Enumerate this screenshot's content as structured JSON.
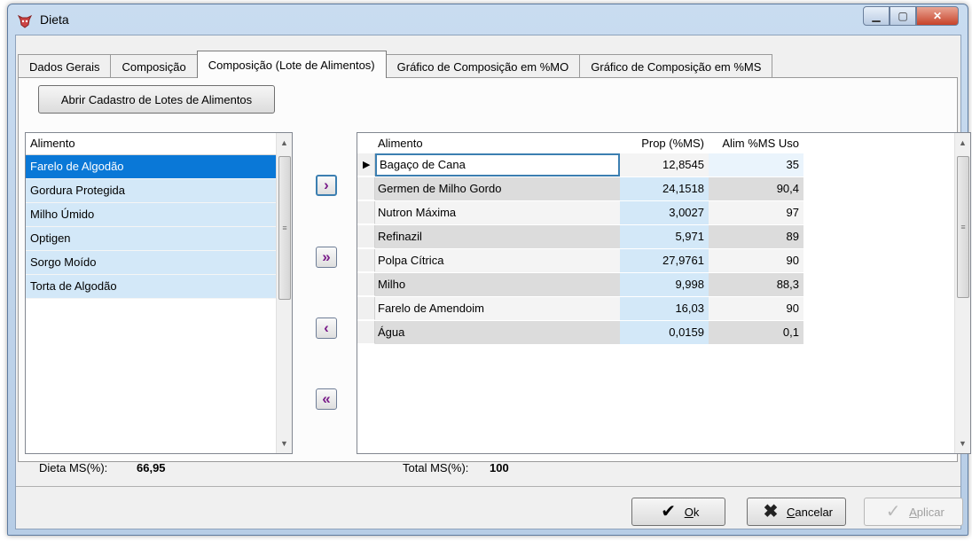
{
  "window": {
    "title": "Dieta"
  },
  "tabs": [
    {
      "label": "Dados Gerais"
    },
    {
      "label": "Composição"
    },
    {
      "label": "Composição (Lote de Alimentos)"
    },
    {
      "label": "Gráfico de Composição em %MO"
    },
    {
      "label": "Gráfico de Composição em %MS"
    }
  ],
  "active_tab": "Composição (Lote de Alimentos)",
  "open_lots_button": "Abrir Cadastro de Lotes de Alimentos",
  "left_list": {
    "header": "Alimento",
    "selected": "Farelo de Algodão",
    "items": [
      "Farelo de Algodão",
      "Gordura Protegida",
      "Milho Úmido",
      "Optigen",
      "Sorgo Moído",
      "Torta de Algodão"
    ]
  },
  "move_buttons": {
    "add_one": "›",
    "add_all": "»",
    "remove_one": "‹",
    "remove_all": "«"
  },
  "grid": {
    "headers": [
      "Alimento",
      "Prop (%MS)",
      "Alim %MS Uso"
    ],
    "rows": [
      {
        "alimento": "Bagaço de Cana",
        "prop": "12,8545",
        "ms": "35"
      },
      {
        "alimento": "Germen de Milho Gordo",
        "prop": "24,1518",
        "ms": "90,4"
      },
      {
        "alimento": "Nutron Máxima",
        "prop": "3,0027",
        "ms": "97"
      },
      {
        "alimento": "Refinazil",
        "prop": "5,971",
        "ms": "89"
      },
      {
        "alimento": "Polpa Cítrica",
        "prop": "27,9761",
        "ms": "90"
      },
      {
        "alimento": "Milho",
        "prop": "9,998",
        "ms": "88,3"
      },
      {
        "alimento": "Farelo de Amendoim",
        "prop": "16,03",
        "ms": "90"
      },
      {
        "alimento": "Água",
        "prop": "0,0159",
        "ms": "0,1"
      }
    ],
    "current_row_indicator": "▶"
  },
  "summary": {
    "dieta_label": "Dieta MS(%):",
    "dieta_value": "66,95",
    "total_label": "Total MS(%):",
    "total_value": "100"
  },
  "buttons": {
    "ok_prefix": "",
    "ok_underlined": "O",
    "ok_rest": "k",
    "cancel_underlined": "C",
    "cancel_rest": "ancelar",
    "apply_underlined": "A",
    "apply_rest": "plicar"
  },
  "colors": {
    "selection": "#0a78d7",
    "list_row": "#d3e8f8",
    "grid_prop": "#d3e8f8",
    "grid_row_light": "#f4f4f4",
    "grid_row_dark": "#dcdcdc",
    "arrow_icon": "#7a1d8a"
  },
  "icons": {
    "app": "cow-head-icon",
    "ok": "checkmark-icon",
    "cancel": "x-icon",
    "apply": "checkmark-icon"
  }
}
